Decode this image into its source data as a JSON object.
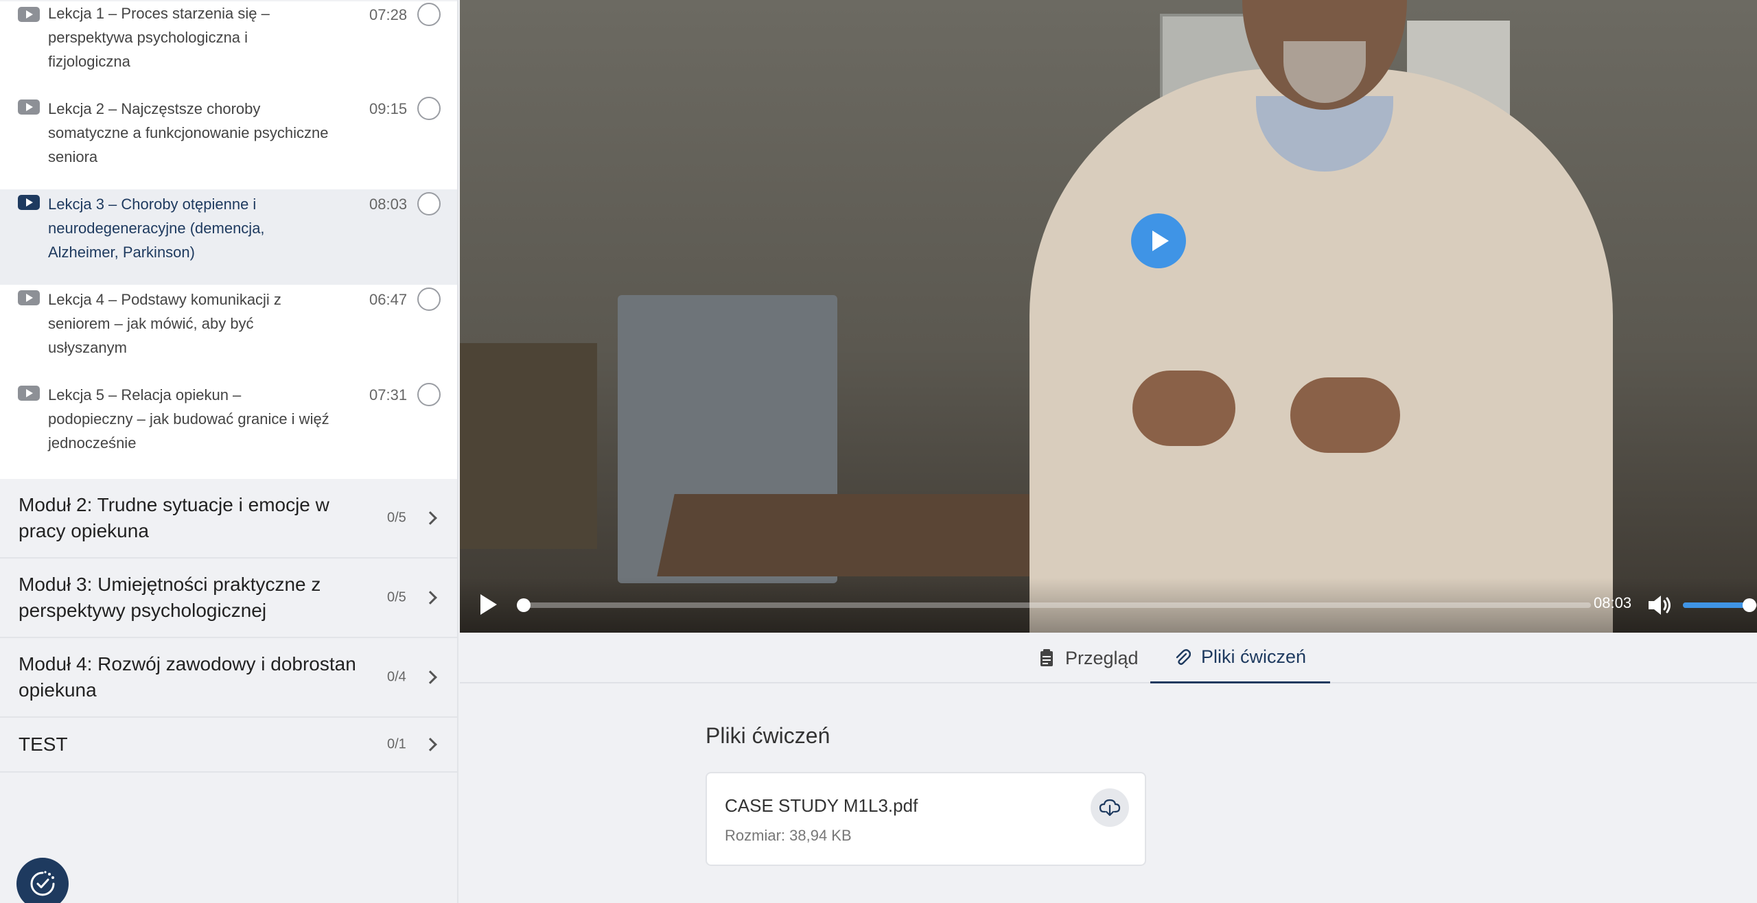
{
  "sidebar": {
    "lessons": [
      {
        "title": "Lekcja 1 – Proces starzenia się – perspektywa psychologiczna i fizjologiczna",
        "duration": "07:28",
        "active": false
      },
      {
        "title": "Lekcja 2 – Najczęstsze choroby somatyczne a funkcjonowanie psychiczne seniora",
        "duration": "09:15",
        "active": false
      },
      {
        "title": "Lekcja 3 – Choroby otępienne i neurodegeneracyjne (demencja, Alzheimer, Parkinson)",
        "duration": "08:03",
        "active": true
      },
      {
        "title": "Lekcja 4 – Podstawy komunikacji z seniorem – jak mówić, aby być usłyszanym",
        "duration": "06:47",
        "active": false
      },
      {
        "title": "Lekcja 5 – Relacja opiekun – podopieczny – jak budować granice i więź jednocześnie",
        "duration": "07:31",
        "active": false
      }
    ],
    "modules": [
      {
        "title": "Moduł 2: Trudne sytuacje i emocje w pracy opiekuna",
        "count": "0/5"
      },
      {
        "title": "Moduł 3: Umiejętności praktyczne z perspektywy psychologicznej",
        "count": "0/5"
      },
      {
        "title": "Moduł 4: Rozwój zawodowy i dobrostan opiekuna",
        "count": "0/4"
      },
      {
        "title": "TEST",
        "count": "0/1"
      }
    ]
  },
  "player": {
    "current_time": "08:03",
    "progress_fraction": 0.003,
    "volume_fraction": 0.9
  },
  "tabs": {
    "overview_label": "Przegląd",
    "files_label": "Pliki ćwiczeń",
    "active": "files"
  },
  "files_section": {
    "title": "Pliki ćwiczeń",
    "file_name": "CASE STUDY M1L3.pdf",
    "file_size": "Rozmiar: 38,94 KB"
  },
  "colors": {
    "accent": "#1e3a5f",
    "play_blue": "#3f94e6",
    "background": "#f0f1f4"
  },
  "icons": {
    "lesson": "play-video-icon",
    "status": "circle-check-icon",
    "module": "chevron-right-icon",
    "overview": "clipboard-icon",
    "files": "paperclip-icon",
    "download": "cloud-download-icon",
    "volume": "speaker-icon",
    "help": "clock-check-icon"
  }
}
